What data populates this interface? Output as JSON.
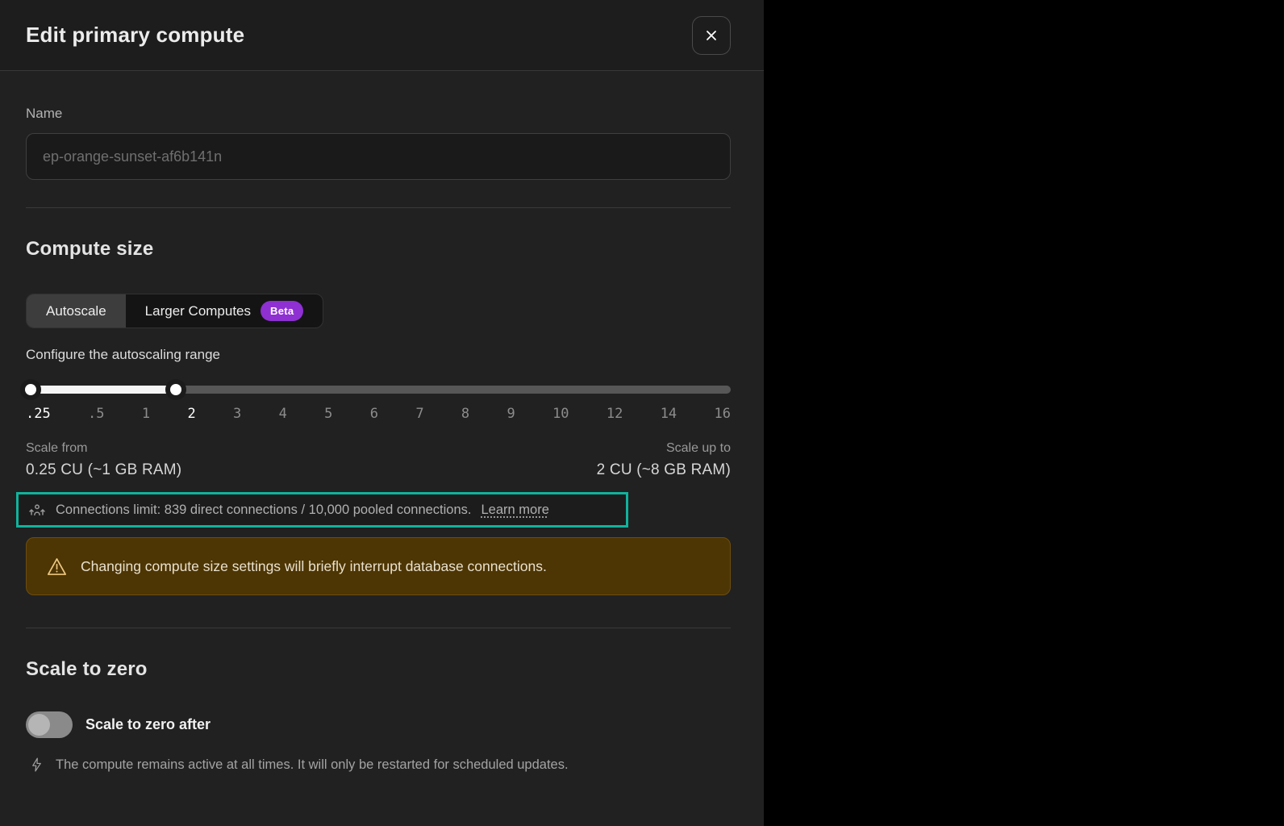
{
  "panel": {
    "title": "Edit primary compute"
  },
  "name_field": {
    "label": "Name",
    "placeholder": "ep-orange-sunset-af6b141n"
  },
  "compute_size": {
    "heading": "Compute size",
    "tabs": [
      {
        "label": "Autoscale",
        "active": true
      },
      {
        "label": "Larger Computes",
        "badge": "Beta",
        "active": false
      }
    ],
    "slider": {
      "label": "Configure the autoscaling range",
      "ticks": [
        ".25",
        ".5",
        "1",
        "2",
        "3",
        "4",
        "5",
        "6",
        "7",
        "8",
        "9",
        "10",
        "12",
        "14",
        "16"
      ],
      "active_ticks": [
        ".25",
        "2"
      ],
      "min_percent": 0.7,
      "max_percent": 21.3,
      "scale_from_label": "Scale from",
      "scale_from_value": "0.25 CU (~1 GB RAM)",
      "scale_to_label": "Scale up to",
      "scale_to_value": "2 CU (~8 GB RAM)"
    },
    "connections_note": {
      "text": "Connections limit: 839 direct connections / 10,000 pooled connections.",
      "link": "Learn more",
      "highlight_color": "#10b39c"
    },
    "warning": {
      "text": "Changing compute size settings will briefly interrupt database connections.",
      "background_color": "#4d3504",
      "icon_color": "#edc882"
    }
  },
  "scale_to_zero": {
    "heading": "Scale to zero",
    "toggle_label": "Scale to zero after",
    "toggle_on": false,
    "info_text": "The compute remains active at all times. It will only be restarted for scheduled updates."
  },
  "colors": {
    "panel_background": "#212121",
    "beta_badge": "#8e30d2",
    "slider_fill": "#f5f5f5"
  }
}
